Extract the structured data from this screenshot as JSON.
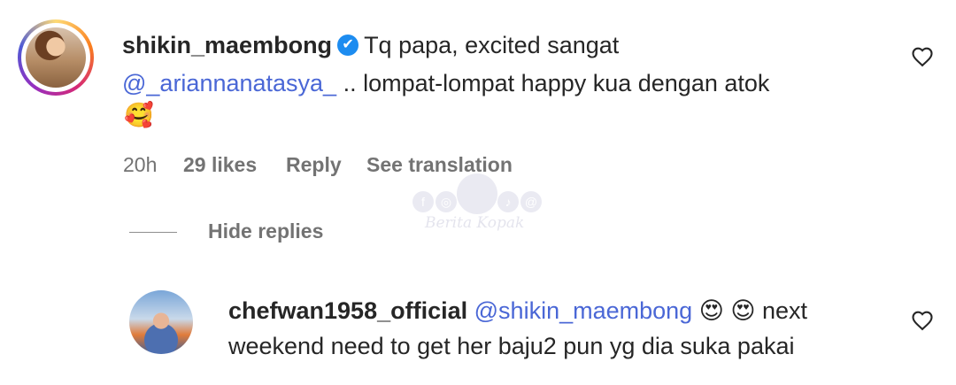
{
  "comment": {
    "username": "shikin_maembong",
    "verified": true,
    "text_line1": "Tq papa, excited sangat",
    "mention": "@_ariannanatasya_",
    "text_line2_rest": " .. lompat-lompat happy kua dengan atok",
    "emoji": "🥰",
    "time": "20h",
    "likes": "29 likes",
    "reply_label": "Reply",
    "translate_label": "See translation",
    "like_icon": "heart-outline-icon"
  },
  "hide_replies_label": "Hide replies",
  "reply": {
    "username": "chefwan1958_official",
    "mention": "@shikin_maembong",
    "emojis": "😍 😍",
    "text_line1_rest": " next",
    "text_line2": "weekend need to get her baju2 pun yg dia suka pakai",
    "like_icon": "heart-outline-icon"
  },
  "watermark": {
    "text": "Berita Kopak"
  }
}
